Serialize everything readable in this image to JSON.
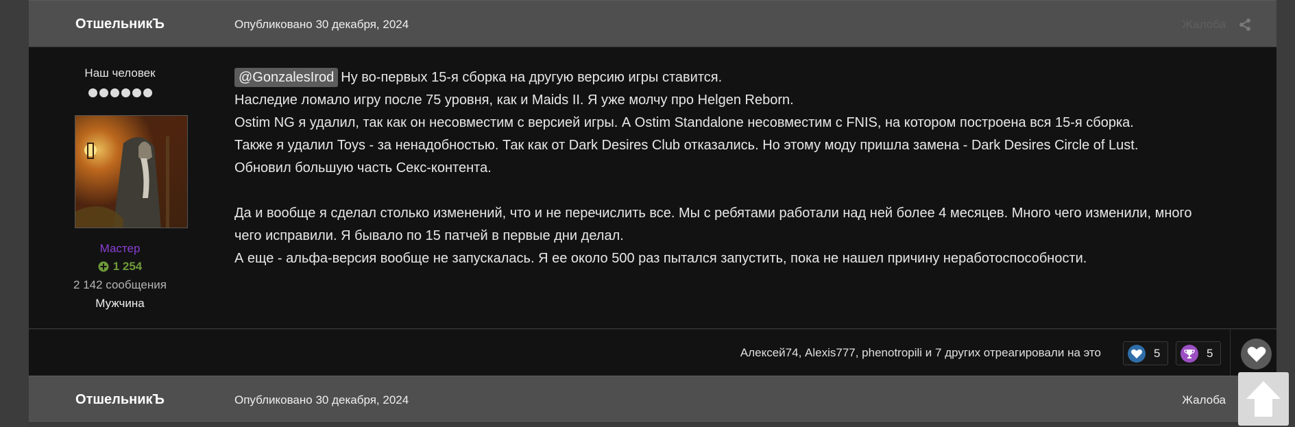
{
  "post1": {
    "author": "ОтшельникЪ",
    "date": "Опубликовано 30 декабря, 2024",
    "report": "Жалоба",
    "rank_title": "Наш человек",
    "group": "Мастер",
    "reputation": "1 254",
    "post_count": "2 142 сообщения",
    "gender": "Мужчина",
    "mention": "@GonzalesIrod",
    "lines": [
      "Ну во-первых 15-я сборка на другую версию игры ставится.",
      "Наследие ломало игру после 75 уровня, как и Maids II. Я уже молчу про Helgen Reborn.",
      "Ostim NG я удалил, так как он несовместим с версией игры. А Ostim Standalone несовместим с FNIS, на котором построена вся 15-я сборка.",
      "Также я удалил Toys - за ненадобностью. Так как от Dark Desires Club отказались. Но этому моду пришла замена - Dark Desires Circle of Lust.",
      "Обновил большую часть Секс-контента.",
      "Да и вообще я сделал столько изменений, что и не перечислить все. Мы с ребятами работали над ней более 4 месяцев. Много чего изменили, много",
      "чего исправили. Я бывало по 15 патчей в первые дни делал.",
      "А еще - альфа-версия вообще не запускалась. Я ее около 500 раз пытался запустить, пока не нашел причину неработоспособности."
    ],
    "reactions_text": "Алексей74, Alexis777, phenotropili и 7 других отреагировали на это",
    "reaction_like_count": "5",
    "reaction_trophy_count": "5"
  },
  "post2": {
    "author": "ОтшельникЪ",
    "date": "Опубликовано 30 декабря, 2024",
    "report": "Жалоба"
  },
  "icons": {
    "share": "share-icon",
    "reputation": "plus-circle-icon",
    "like": "like-heart-icon",
    "trophy": "trophy-icon",
    "heart": "heart-icon",
    "scroll_top": "arrow-up-icon"
  },
  "colors": {
    "group": "#8a3fd6",
    "reputation": "#6f9a3a",
    "header_bg": "#4f4f4f",
    "body_bg": "#121212"
  }
}
